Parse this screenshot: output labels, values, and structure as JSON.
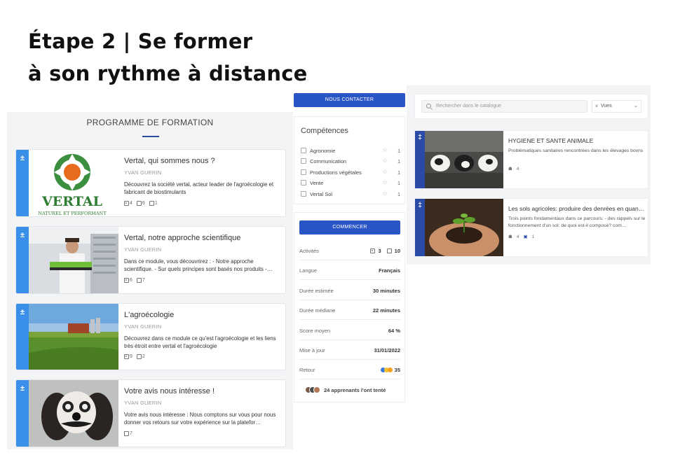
{
  "headline": {
    "line1": "Étape 2 | Se former",
    "line2": "à son rythme à distance"
  },
  "programme": {
    "title": "PROGRAMME DE FORMATION",
    "modules": [
      {
        "title": "Vertal, qui sommes nous ?",
        "author": "YVAN GUERIN",
        "desc": "Découvrez la société vertal, acteur leader de l'agroécologie et fabricant de biostimulants",
        "stats": [
          "4",
          "6",
          "1"
        ],
        "logo_text": "VERTAL",
        "logo_sub": "NATUREL ET PERFORMANT"
      },
      {
        "title": "Vertal, notre approche scientifique",
        "author": "YVAN GUERIN",
        "desc": "Dans ce module, vous découvrirez : - Notre approche scientifique. - Sur quels principes sont basés nos produits -…",
        "stats": [
          "6",
          "7"
        ]
      },
      {
        "title": "L'agroécologie",
        "author": "YVAN GUERIN",
        "desc": "Découvrez dans ce module ce qu'est l'agroécologie et les liens très étroit entre vertal et l'agroécologie",
        "stats": [
          "9",
          "2"
        ]
      },
      {
        "title": "Votre avis nous intéresse !",
        "author": "YVAN GUERIN",
        "desc": "Votre avis nous intéresse : Nous comptons sur vous pour nous donner vos retours sur votre expérience sur la platefor…",
        "stats": [
          "7"
        ]
      }
    ]
  },
  "contact": {
    "label": "NOUS CONTACTER"
  },
  "competences": {
    "title": "Compétences",
    "items": [
      {
        "label": "Agronomie",
        "count": "1"
      },
      {
        "label": "Communication",
        "count": "1"
      },
      {
        "label": "Productions végétales",
        "count": "1"
      },
      {
        "label": "Vente",
        "count": "1"
      },
      {
        "label": "Vertal Sol",
        "count": "1"
      }
    ]
  },
  "info": {
    "start_label": "COMMENCER",
    "activites_label": "Activités",
    "activites_a": "3",
    "activites_b": "10",
    "rows": [
      {
        "k": "Langue",
        "v": "Français"
      },
      {
        "k": "Durée estimée",
        "v": "30 minutes"
      },
      {
        "k": "Durée médiane",
        "v": "22 minutes"
      },
      {
        "k": "Score moyen",
        "v": "64 %"
      },
      {
        "k": "Mise à jour",
        "v": "31/01/2022"
      }
    ],
    "retour_label": "Retour",
    "retour_value": "35",
    "learners": "24 apprenants l'ont tenté"
  },
  "catalogue": {
    "search_placeholder": "Rechercher dans le catalogue",
    "filter_value": "Vues",
    "items": [
      {
        "title": "HYGIENE ET SANTE ANIMALE",
        "desc": "Problématiques sanitaires rencontrées dans les élevages bovns",
        "meta": [
          "4"
        ]
      },
      {
        "title": "Les sols agricoles: produire des denrées en quan…",
        "desc": "Trois points fondamentaux dans ce parcours: - des rappels sur le fonctionnement d'un sol: de quoi est-il composé? com…",
        "meta": [
          "4",
          "1"
        ]
      }
    ]
  },
  "colors": {
    "primary": "#2a55c7",
    "module_bar": "#3a8fe8",
    "catalogue_bar": "#2a4aa8",
    "brand_green": "#2e7d32"
  }
}
